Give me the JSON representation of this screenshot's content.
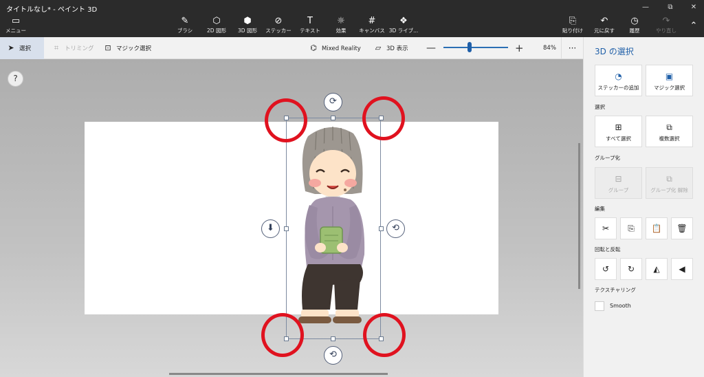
{
  "window": {
    "title": "タイトルなし* - ペイント 3D",
    "minimize": "—",
    "maximize": "⧉",
    "close": "✕"
  },
  "toolbar": {
    "menu": {
      "label": "メニュー",
      "icon": "menu-icon"
    },
    "tools": [
      {
        "label": "ブラシ",
        "icon": "brush-icon",
        "glyph": "✎"
      },
      {
        "label": "2D 図形",
        "icon": "shapes-2d-icon",
        "glyph": "⬡"
      },
      {
        "label": "3D 図形",
        "icon": "cube-icon",
        "glyph": "⬢"
      },
      {
        "label": "ステッカー",
        "icon": "sticker-icon",
        "glyph": "⊘"
      },
      {
        "label": "テキスト",
        "icon": "text-icon",
        "glyph": "T"
      },
      {
        "label": "効果",
        "icon": "sun-icon",
        "glyph": "☼"
      },
      {
        "label": "キャンバス",
        "icon": "canvas-icon",
        "glyph": "#"
      },
      {
        "label": "3D ライブ...",
        "icon": "library-icon",
        "glyph": "❖"
      }
    ],
    "actions": [
      {
        "label": "貼り付け",
        "icon": "paste-icon",
        "glyph": "⎘"
      },
      {
        "label": "元に戻す",
        "icon": "undo-icon",
        "glyph": "↶"
      },
      {
        "label": "履歴",
        "icon": "history-icon",
        "glyph": "◷"
      },
      {
        "label": "やり直し",
        "icon": "redo-icon",
        "glyph": "↷"
      }
    ],
    "collapse_glyph": "⌃"
  },
  "subtoolbar": {
    "select": "選択",
    "trim": "トリミング",
    "magic_select": "マジック選択",
    "mixed_reality": "Mixed Reality",
    "view_3d": "3D 表示",
    "zoom_minus": "—",
    "zoom_plus": "+",
    "zoom": "84%",
    "zoom_level": 0.4,
    "more": "···"
  },
  "canvas": {
    "help": "?"
  },
  "selection": {
    "rotate_top_glyph": "⟳",
    "rotate_right_glyph": "⟲",
    "rotate_bottom_glyph": "⟲",
    "push_back_glyph": "⬇"
  },
  "panel": {
    "title": "3D の選択",
    "add_sticker": "ステッカーの追加",
    "magic_select": "マジック選択",
    "select_section": "選択",
    "select_all": "すべて選択",
    "multi_select": "複数選択",
    "group_section": "グループ化",
    "group": "グループ",
    "ungroup": "グループ化 解除",
    "edit_section": "編集",
    "cut_glyph": "✂",
    "copy_glyph": "⎘",
    "paste_glyph": "📋",
    "delete_glyph": "🗑",
    "rotate_flip_section": "回転と反転",
    "rotate_left_glyph": "↺",
    "rotate_right_glyph": "↻",
    "flip_h_glyph": "◭",
    "flip_v_glyph": "◀",
    "texturing_section": "テクスチャリング",
    "smooth": "Smooth"
  },
  "colors": {
    "accent": "#1f5fa8",
    "highlight_ring": "#e0121f",
    "toolbar_bg": "#2b2b2b"
  }
}
